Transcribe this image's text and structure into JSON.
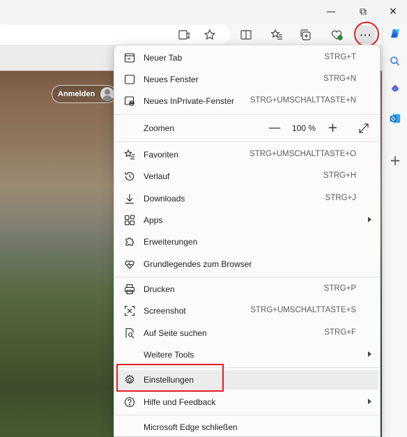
{
  "window": {
    "minimize": "—",
    "restore": "⧉",
    "close": "✕"
  },
  "toolbar": {
    "icons": [
      "read-aloud-icon",
      "favorite-star-icon",
      "split-screen-icon",
      "favorites-icon",
      "collections-icon",
      "browser-essentials-icon",
      "more-icon"
    ],
    "more_label": "···"
  },
  "page": {
    "signin_label": "Anmelden"
  },
  "sidebar": {
    "add_label": "+"
  },
  "menu": {
    "items": [
      {
        "label": "Neuer Tab",
        "shortcut": "STRG+T",
        "icon": "new-tab-icon"
      },
      {
        "label": "Neues Fenster",
        "shortcut": "STRG+N",
        "icon": "new-window-icon"
      },
      {
        "label": "Neues InPrivate-Fenster",
        "shortcut": "STRG+UMSCHALTTASTE+N",
        "icon": "inprivate-icon"
      },
      {
        "label": "Zoomen",
        "shortcut": "",
        "icon": ""
      },
      {
        "label": "Favoriten",
        "shortcut": "STRG+UMSCHALTTASTE+O",
        "icon": "favorites-icon"
      },
      {
        "label": "Verlauf",
        "shortcut": "STRG+H",
        "icon": "history-icon"
      },
      {
        "label": "Downloads",
        "shortcut": "STRG+J",
        "icon": "download-icon"
      },
      {
        "label": "Apps",
        "shortcut": "",
        "icon": "apps-icon"
      },
      {
        "label": "Erweiterungen",
        "shortcut": "",
        "icon": "extensions-icon"
      },
      {
        "label": "Grundlegendes zum Browser",
        "shortcut": "",
        "icon": "browser-essentials-icon"
      },
      {
        "label": "Drucken",
        "shortcut": "STRG+P",
        "icon": "print-icon"
      },
      {
        "label": "Screenshot",
        "shortcut": "STRG+UMSCHALTTASTE+S",
        "icon": "screenshot-icon"
      },
      {
        "label": "Auf Seite suchen",
        "shortcut": "STRG+F",
        "icon": "find-icon"
      },
      {
        "label": "Weitere Tools",
        "shortcut": "",
        "icon": ""
      },
      {
        "label": "Einstellungen",
        "shortcut": "",
        "icon": "settings-icon"
      },
      {
        "label": "Hilfe und Feedback",
        "shortcut": "",
        "icon": "help-icon"
      },
      {
        "label": "Microsoft Edge schließen",
        "shortcut": "",
        "icon": ""
      }
    ],
    "zoom": {
      "minus": "—",
      "value": "100 %",
      "plus": "+"
    }
  },
  "colors": {
    "highlight": "#e21b22",
    "copilot": "#2f7bf5",
    "outlook": "#0f6cbd"
  }
}
